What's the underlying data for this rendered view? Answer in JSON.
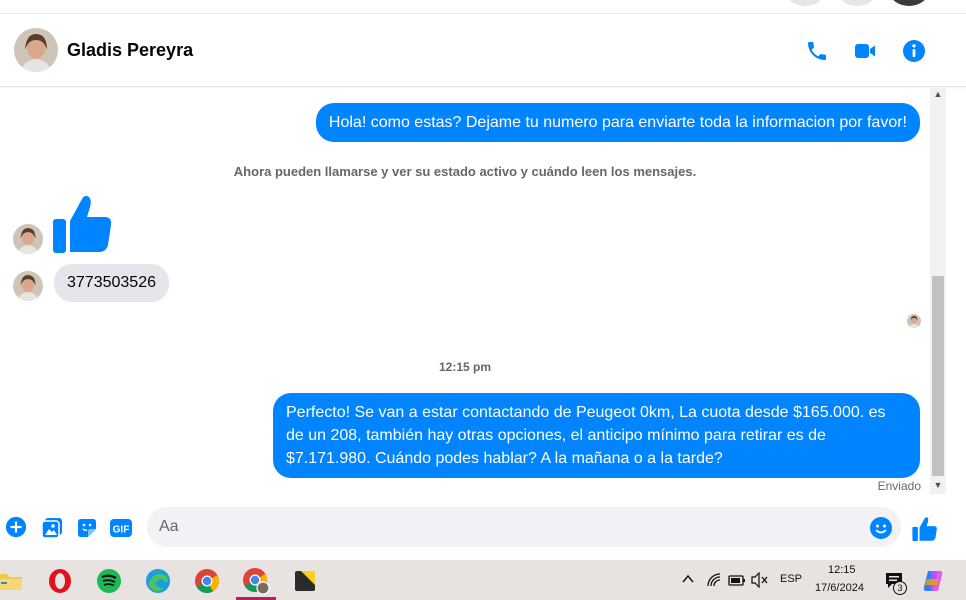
{
  "contact": {
    "name": "Gladis Pereyra"
  },
  "header_icons": [
    "phone-icon",
    "video-camera-icon",
    "info-icon"
  ],
  "messages": {
    "m1": "Hola! como estas? Dejame tu numero para enviarte toda la informacion por favor!",
    "system": "Ahora pueden llamarse y ver su estado activo y cuándo leen los mensajes.",
    "phone_number": "3773503526",
    "time": "12:15 pm",
    "m2_line1": "Perfecto!  Se van a estar contactando de Peugeot 0km, La cuota desde $165.000. es",
    "m2_line2": "de un 208, también hay otras opciones, el anticipo mínimo para retirar es de",
    "m2_line3": "$7.171.980. Cuándo podes hablar? A la mañana o a la tarde?",
    "status": "Enviado"
  },
  "composer": {
    "placeholder": "Aa",
    "gif_label": "GIF"
  },
  "taskbar": {
    "language": "ESP",
    "time": "12:15",
    "date": "17/6/2024",
    "notification_count": "3",
    "apps": [
      "file-explorer",
      "opera",
      "spotify",
      "edge",
      "chrome",
      "chrome-profile",
      "sticky-notes"
    ]
  },
  "colors": {
    "accent": "#0084ff",
    "bubble_in": "#e4e6eb",
    "taskbar": "#e8e3e0",
    "active_indicator": "#c3185d"
  }
}
